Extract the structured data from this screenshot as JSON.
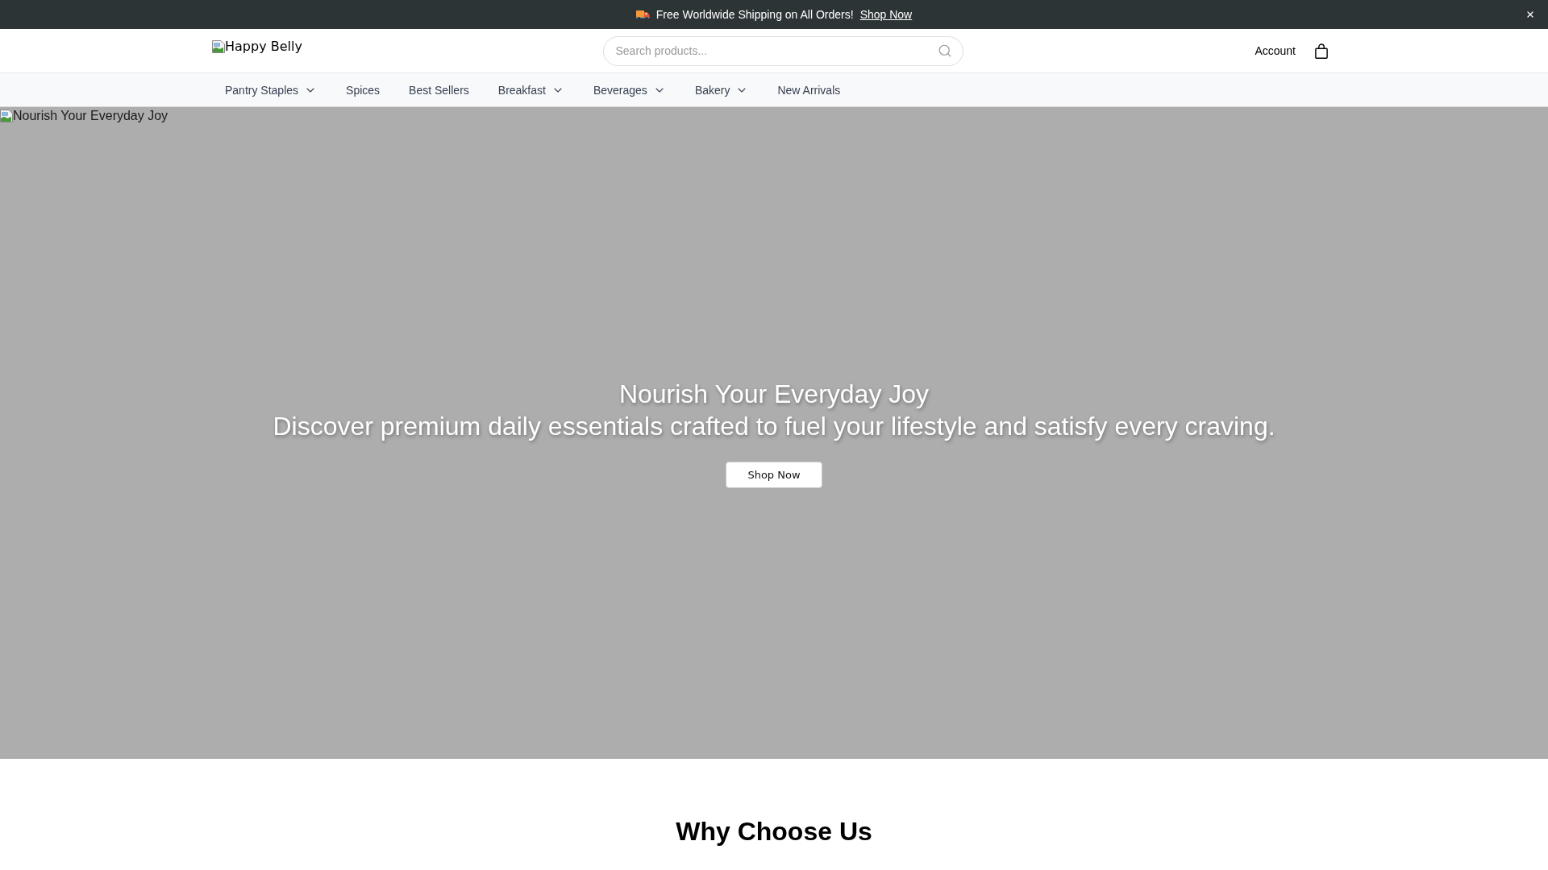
{
  "announcement": {
    "text": "Free Worldwide Shipping on All Orders!",
    "link": "Shop Now"
  },
  "header": {
    "logo_alt": "Happy Belly",
    "search": {
      "placeholder": "Search products..."
    },
    "account": "Account"
  },
  "nav": [
    {
      "label": "Pantry Staples",
      "kind": "dropdown"
    },
    {
      "label": "Spices",
      "kind": "link"
    },
    {
      "label": "Best Sellers",
      "kind": "link"
    },
    {
      "label": "Breakfast",
      "kind": "dropdown"
    },
    {
      "label": "Beverages",
      "kind": "dropdown"
    },
    {
      "label": "Bakery",
      "kind": "dropdown"
    },
    {
      "label": "New Arrivals",
      "kind": "link"
    }
  ],
  "hero": {
    "image_alt": "Nourish Your Everyday Joy",
    "title": "Nourish Your Everyday Joy",
    "subtitle": "Discover premium daily essentials crafted to fuel your lifestyle and satisfy every craving.",
    "button": "Shop Now"
  },
  "section": {
    "title": "Why Choose Us"
  }
}
